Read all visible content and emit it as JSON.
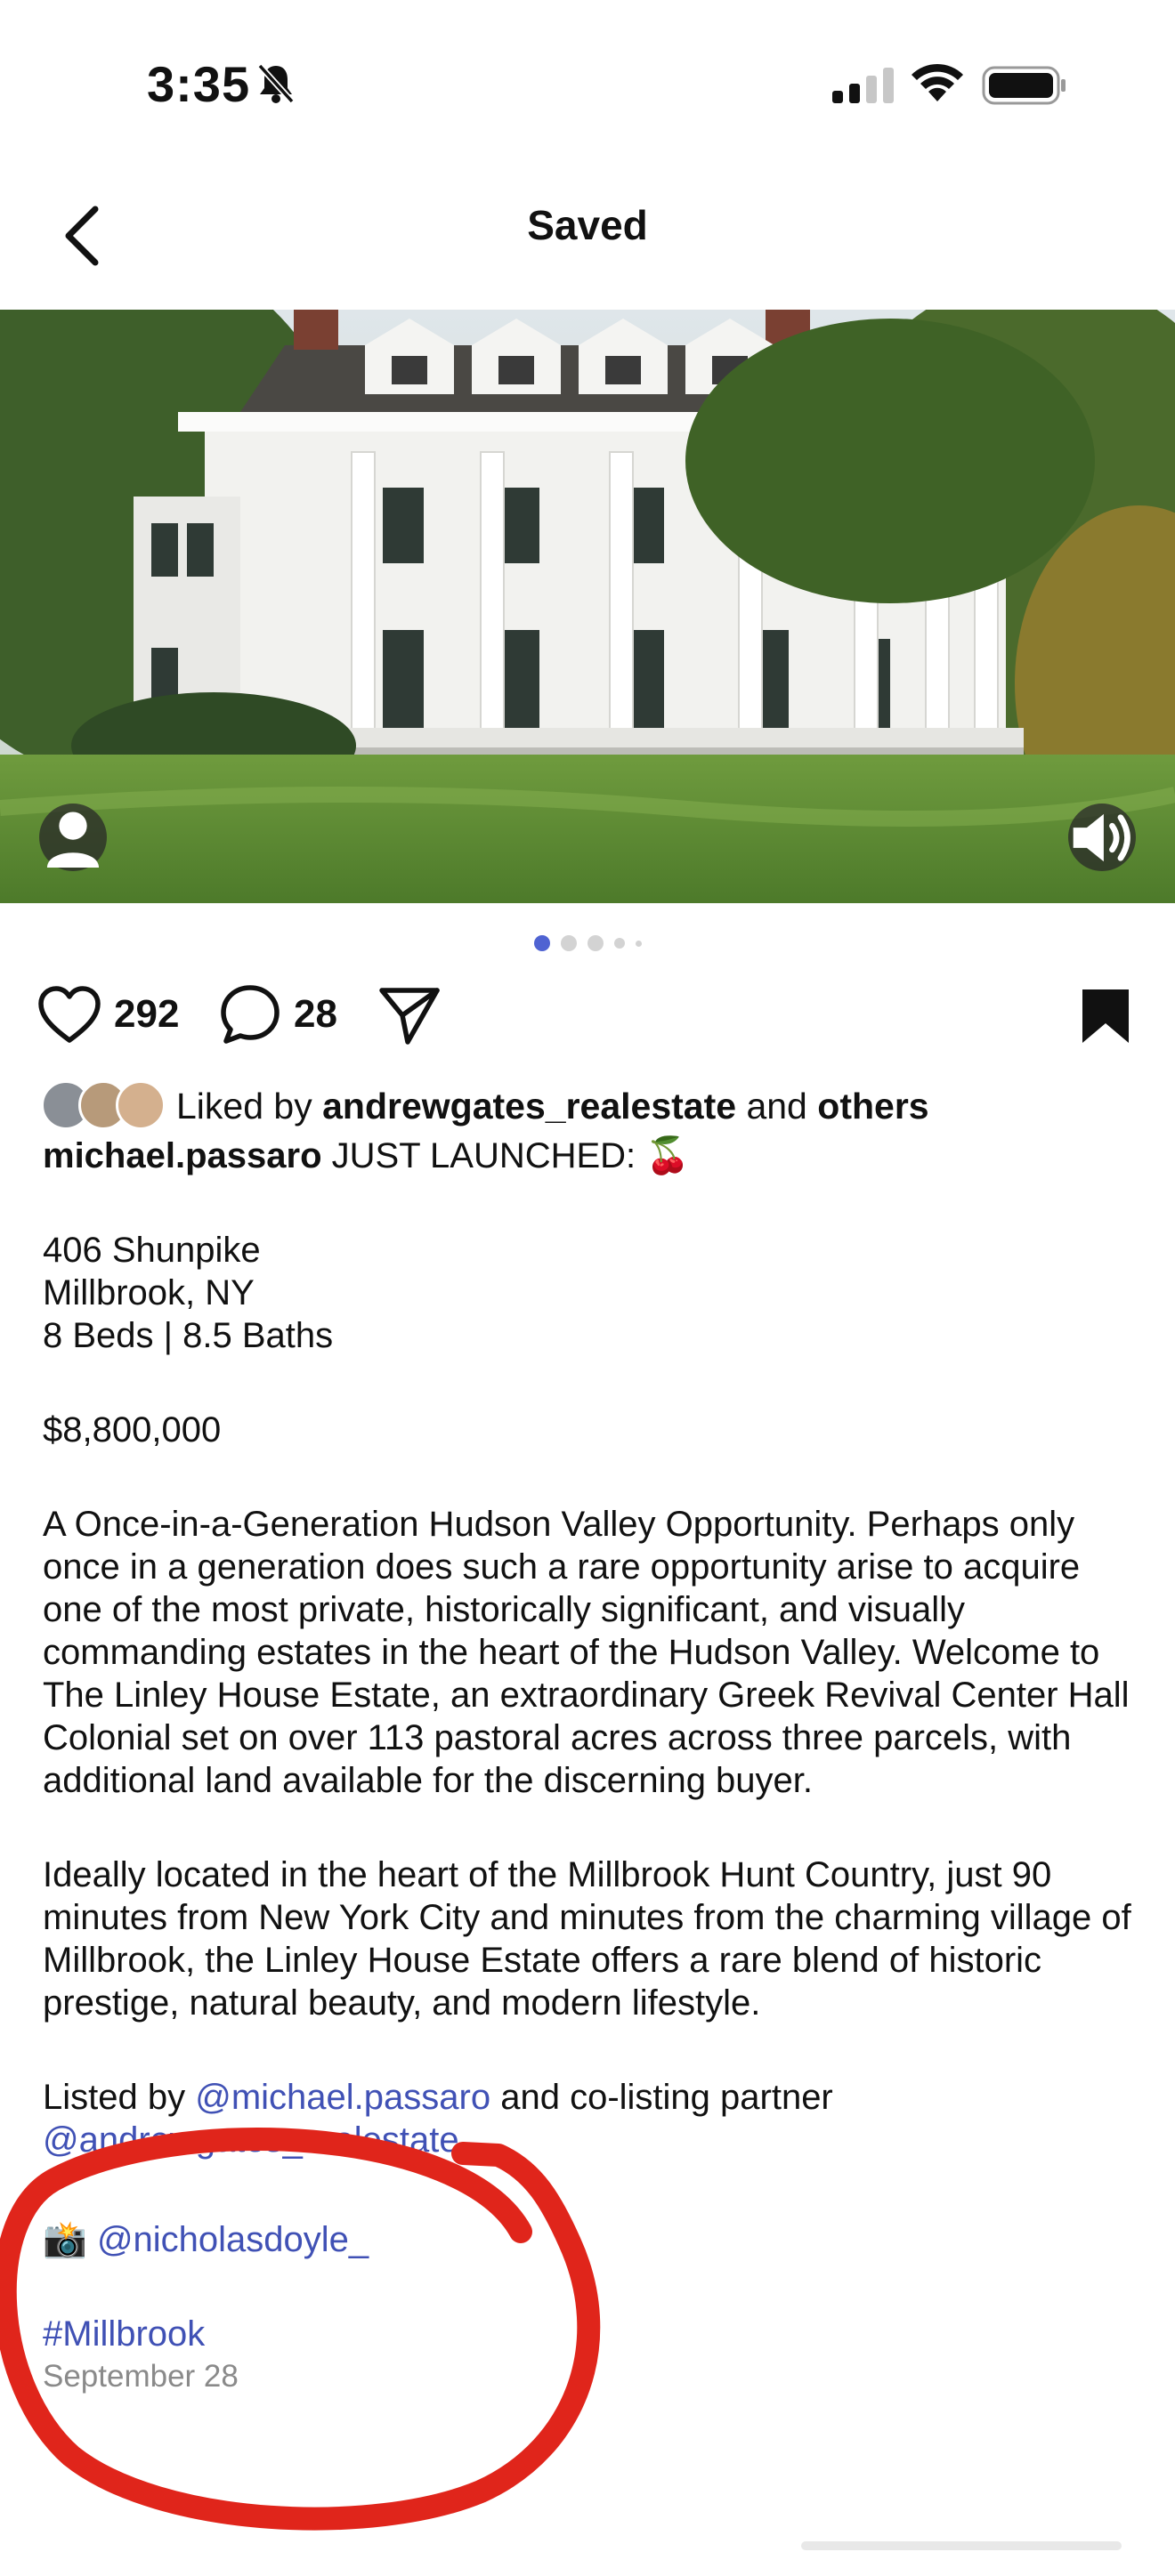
{
  "status_bar": {
    "time": "3:35",
    "icons": [
      "bell-slash-icon",
      "signal-icon",
      "wifi-icon",
      "battery-icon"
    ]
  },
  "header": {
    "title": "Saved",
    "back_icon": "chevron-left-icon"
  },
  "post": {
    "image_icons": [
      "person-tag-icon",
      "speaker-icon"
    ],
    "carousel": {
      "total": 5,
      "active_index": 0
    },
    "likes": "292",
    "comments": "28",
    "liked_by": {
      "prefix": "Liked by",
      "user": "andrewgates_realestate",
      "connector": "and",
      "others": "others"
    },
    "caption": {
      "author": "michael.passaro",
      "headline": "JUST LAUNCHED: 🍒",
      "address_line1": "406 Shunpike",
      "address_line2": "Millbrook, NY",
      "specs": "8 Beds | 8.5 Baths",
      "price": "$8,800,000",
      "paragraph1": "A Once-in-a-Generation Hudson Valley Opportunity. Perhaps only once in a generation does such a rare opportunity arise to acquire one of the most private, historically significant, and visually commanding estates in the heart of the Hudson Valley. Welcome to The Linley House Estate, an extraordinary Greek Revival Center Hall Colonial set on over 113 pastoral acres across three parcels, with additional land available for the discerning buyer.",
      "paragraph2": "Ideally located in the heart of the Millbrook Hunt Country, just 90 minutes from New York City and minutes from the charming village of Millbrook, the Linley House Estate offers a rare blend of historic prestige, natural beauty, and modern lifestyle.",
      "listed_prefix": "Listed by",
      "listed_user": "@michael.passaro",
      "listed_mid": "and co-listing partner",
      "partner_user": "@andrewgates_realestate",
      "photo_emoji": "📸",
      "photographer": "@nicholasdoyle_",
      "hashtag": "#Millbrook"
    },
    "date": "September 28"
  },
  "colors": {
    "link": "#4051b5",
    "annotation": "#e0251b",
    "active_dot": "#4f63d2"
  }
}
